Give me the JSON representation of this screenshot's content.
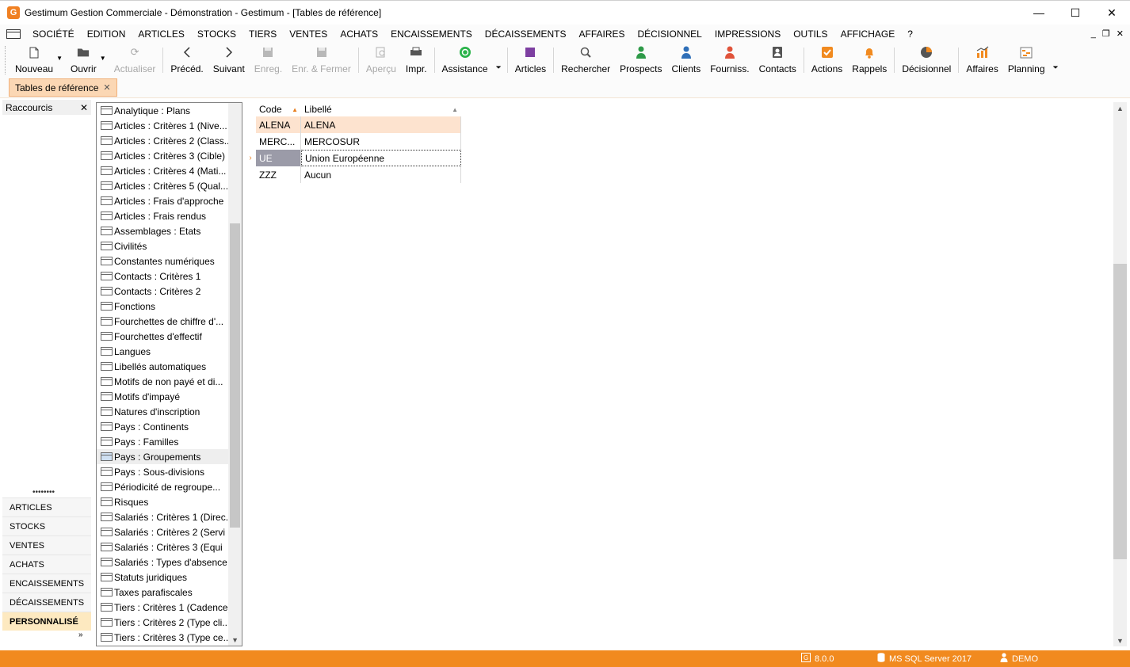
{
  "window": {
    "title": "Gestimum Gestion Commerciale - Démonstration - Gestimum - [Tables de référence]",
    "app_icon_letter": "G",
    "minimize": "—",
    "maximize": "☐",
    "close": "✕"
  },
  "menu": {
    "items": [
      "SOCIÉTÉ",
      "EDITION",
      "ARTICLES",
      "STOCKS",
      "TIERS",
      "VENTES",
      "ACHATS",
      "ENCAISSEMENTS",
      "DÉCAISSEMENTS",
      "AFFAIRES",
      "DÉCISIONNEL",
      "IMPRESSIONS",
      "OUTILS",
      "AFFICHAGE",
      "?"
    ],
    "mdi_minimize": "_",
    "mdi_restore": "❐",
    "mdi_close": "✕"
  },
  "toolbar": {
    "nouveau": "Nouveau",
    "ouvrir": "Ouvrir",
    "actualiser": "Actualiser",
    "preced": "Précéd.",
    "suivant": "Suivant",
    "enreg": "Enreg.",
    "enr_fermer": "Enr. & Fermer",
    "apercu": "Aperçu",
    "impr": "Impr.",
    "assistance": "Assistance",
    "articles": "Articles",
    "rechercher": "Rechercher",
    "prospects": "Prospects",
    "clients": "Clients",
    "fourniss": "Fourniss.",
    "contacts": "Contacts",
    "actions": "Actions",
    "rappels": "Rappels",
    "decisionnel": "Décisionnel",
    "affaires": "Affaires",
    "planning": "Planning"
  },
  "colors": {
    "accent": "#f18a1f",
    "tab_bg": "#fbd7b4",
    "row_highlight": "#fde3cf",
    "current_code_bg": "#9b9ba8"
  },
  "doc_tab": {
    "label": "Tables de référence",
    "close": "✕"
  },
  "shortcuts": {
    "title": "Raccourcis",
    "close": "✕",
    "dots": "••••••••",
    "more": "»",
    "items": [
      "ARTICLES",
      "STOCKS",
      "VENTES",
      "ACHATS",
      "ENCAISSEMENTS",
      "DÉCAISSEMENTS",
      "PERSONNALISÉ"
    ]
  },
  "tree": {
    "items": [
      "Analytique : Plans",
      "Articles : Critères 1 (Nive...",
      "Articles : Critères 2 (Class...",
      "Articles : Critères 3 (Cible)",
      "Articles : Critères 4 (Mati...",
      "Articles : Critères 5 (Qual...",
      "Articles : Frais d'approche",
      "Articles : Frais rendus",
      "Assemblages : Etats",
      "Civilités",
      "Constantes numériques",
      "Contacts : Critères 1",
      "Contacts : Critères 2",
      "Fonctions",
      "Fourchettes de chiffre d'...",
      "Fourchettes d'effectif",
      "Langues",
      "Libellés automatiques",
      "Motifs de non payé et di...",
      "Motifs d'impayé",
      "Natures d'inscription",
      "Pays : Continents",
      "Pays : Familles",
      "Pays : Groupements",
      "Pays : Sous-divisions",
      "Périodicité de regroupe...",
      "Risques",
      "Salariés : Critères 1 (Direc...",
      "Salariés : Critères 2 (Servi",
      "Salariés : Critères 3 (Equi",
      "Salariés : Types d'absence",
      "Statuts juridiques",
      "Taxes parafiscales",
      "Tiers : Critères 1 (Cadence)",
      "Tiers : Critères 2 (Type cli...",
      "Tiers : Critères 3 (Type ce..."
    ],
    "selected": "Pays : Groupements",
    "scroll_down": "▼"
  },
  "grid": {
    "headers": {
      "code": "Code",
      "libelle": "Libellé"
    },
    "sort_icon": "▲",
    "current_indicator": "›",
    "rows": [
      {
        "code": "ALENA",
        "libelle": "ALENA"
      },
      {
        "code": "MERC...",
        "libelle": "MERCOSUR"
      },
      {
        "code": "UE",
        "libelle": "Union Européenne"
      },
      {
        "code": "ZZZ",
        "libelle": "Aucun"
      }
    ]
  },
  "scrollbar": {
    "up": "▲",
    "down": "▼"
  },
  "status": {
    "version": "8.0.0",
    "server": "MS SQL Server 2017",
    "user": "DEMO"
  }
}
